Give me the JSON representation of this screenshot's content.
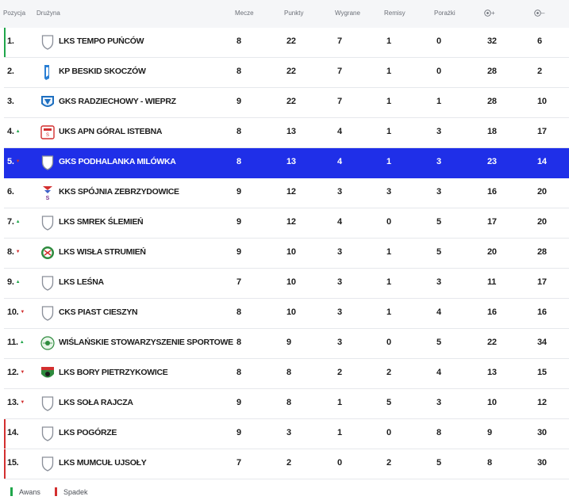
{
  "header": {
    "pozycja": "Pozycja",
    "druzyna": "Drużyna",
    "mecze": "Mecze",
    "punkty": "Punkty",
    "wygrane": "Wygrane",
    "remisy": "Remisy",
    "porazki": "Porażki",
    "goals_for_suffix": "+",
    "goals_against_suffix": "–"
  },
  "rows": [
    {
      "pos": "1.",
      "trend": "",
      "team": "LKS Tempo Puńców",
      "crest": "shield",
      "zone": "promo",
      "mecze": "8",
      "punkty": "22",
      "wygrane": "7",
      "remisy": "1",
      "porazki": "0",
      "gf": "32",
      "ga": "6"
    },
    {
      "pos": "2.",
      "trend": "",
      "team": "KP Beskid Skoczów",
      "crest": "crest-blue",
      "zone": "",
      "mecze": "8",
      "punkty": "22",
      "wygrane": "7",
      "remisy": "1",
      "porazki": "0",
      "gf": "28",
      "ga": "2"
    },
    {
      "pos": "3.",
      "trend": "",
      "team": "GKS Radziechowy - Wieprz",
      "crest": "crest-blue2",
      "zone": "",
      "mecze": "9",
      "punkty": "22",
      "wygrane": "7",
      "remisy": "1",
      "porazki": "1",
      "gf": "28",
      "ga": "10"
    },
    {
      "pos": "4.",
      "trend": "up",
      "team": "UKS APN Góral Istebna",
      "crest": "crest-red",
      "zone": "",
      "mecze": "8",
      "punkty": "13",
      "wygrane": "4",
      "remisy": "1",
      "porazki": "3",
      "gf": "18",
      "ga": "17"
    },
    {
      "pos": "5.",
      "trend": "down",
      "team": "GKS Podhalanka Milówka",
      "crest": "shield",
      "zone": "",
      "highlight": true,
      "mecze": "8",
      "punkty": "13",
      "wygrane": "4",
      "remisy": "1",
      "porazki": "3",
      "gf": "23",
      "ga": "14"
    },
    {
      "pos": "6.",
      "trend": "",
      "team": "KKS Spójnia Zebrzydowice",
      "crest": "crest-s",
      "zone": "",
      "mecze": "9",
      "punkty": "12",
      "wygrane": "3",
      "remisy": "3",
      "porazki": "3",
      "gf": "16",
      "ga": "20"
    },
    {
      "pos": "7.",
      "trend": "up",
      "team": "LKS Smrek Ślemień",
      "crest": "shield",
      "zone": "",
      "mecze": "9",
      "punkty": "12",
      "wygrane": "4",
      "remisy": "0",
      "porazki": "5",
      "gf": "17",
      "ga": "20"
    },
    {
      "pos": "8.",
      "trend": "down",
      "team": "LKS Wisła Strumień",
      "crest": "crest-green",
      "zone": "",
      "mecze": "9",
      "punkty": "10",
      "wygrane": "3",
      "remisy": "1",
      "porazki": "5",
      "gf": "20",
      "ga": "28"
    },
    {
      "pos": "9.",
      "trend": "up",
      "team": "LKS Leśna",
      "crest": "shield",
      "zone": "",
      "mecze": "7",
      "punkty": "10",
      "wygrane": "3",
      "remisy": "1",
      "porazki": "3",
      "gf": "11",
      "ga": "17"
    },
    {
      "pos": "10.",
      "trend": "down",
      "team": "CKS Piast Cieszyn",
      "crest": "shield",
      "zone": "",
      "mecze": "8",
      "punkty": "10",
      "wygrane": "3",
      "remisy": "1",
      "porazki": "4",
      "gf": "16",
      "ga": "16"
    },
    {
      "pos": "11.",
      "trend": "up",
      "team": "Wiślańskie Stowarzyszenie Sportowe",
      "crest": "crest-wss",
      "zone": "",
      "mecze": "8",
      "punkty": "9",
      "wygrane": "3",
      "remisy": "0",
      "porazki": "5",
      "gf": "22",
      "ga": "34"
    },
    {
      "pos": "12.",
      "trend": "down",
      "team": "LKS Bory Pietrzykowice",
      "crest": "crest-bory",
      "zone": "",
      "mecze": "8",
      "punkty": "8",
      "wygrane": "2",
      "remisy": "2",
      "porazki": "4",
      "gf": "13",
      "ga": "15"
    },
    {
      "pos": "13.",
      "trend": "down",
      "team": "LKS Soła Rajcza",
      "crest": "shield",
      "zone": "",
      "mecze": "9",
      "punkty": "8",
      "wygrane": "1",
      "remisy": "5",
      "porazki": "3",
      "gf": "10",
      "ga": "12"
    },
    {
      "pos": "14.",
      "trend": "",
      "team": "LKS Pogórze",
      "crest": "shield",
      "zone": "releg",
      "mecze": "9",
      "punkty": "3",
      "wygrane": "1",
      "remisy": "0",
      "porazki": "8",
      "gf": "9",
      "ga": "30"
    },
    {
      "pos": "15.",
      "trend": "",
      "team": "LKS Mumcuł Ujsoły",
      "crest": "shield",
      "zone": "releg",
      "mecze": "7",
      "punkty": "2",
      "wygrane": "0",
      "remisy": "2",
      "porazki": "5",
      "gf": "8",
      "ga": "30"
    }
  ],
  "legend": {
    "awans": "Awans",
    "spadek": "Spadek"
  },
  "colors": {
    "highlight": "#1f2fe8",
    "promotion": "#1fa64a",
    "relegation": "#d32f2f"
  }
}
